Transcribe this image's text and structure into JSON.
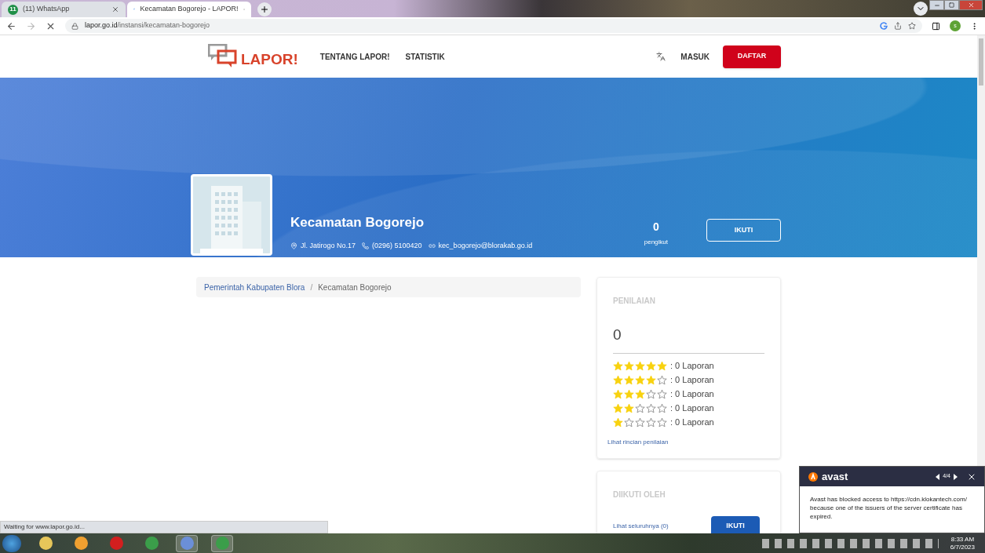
{
  "browser": {
    "tabs": [
      {
        "title": "(11) WhatsApp",
        "badge": "11",
        "selected": false
      },
      {
        "title": "Kecamatan Bogorejo - LAPOR!",
        "selected": true
      }
    ],
    "url_host": "lapor.go.id",
    "url_path": "/instansi/kecamatan-bogorejo",
    "profile_initial": "s"
  },
  "header": {
    "logo": "LAPOR!",
    "nav": [
      "TENTANG LAPOR!",
      "STATISTIK"
    ],
    "login": "MASUK",
    "register": "DAFTAR"
  },
  "profile": {
    "name": "Kecamatan Bogorejo",
    "address": "Jl. Jatirogo No.17",
    "phone": "(0296) 5100420",
    "email": "kec_bogorejo@blorakab.go.id",
    "followers_count": "0",
    "followers_label": "pengikut",
    "follow_button": "IKUTI"
  },
  "breadcrumb": [
    {
      "label": "Pemerintah Kabupaten Blora",
      "kind": "link"
    },
    {
      "label": "Kecamatan Bogorejo",
      "kind": "current"
    }
  ],
  "breadcrumb_separator": "/",
  "rating": {
    "title": "PENILAIAN",
    "score": "0",
    "rows": [
      {
        "stars": 5,
        "text": ": 0 Laporan"
      },
      {
        "stars": 4,
        "text": ": 0 Laporan"
      },
      {
        "stars": 3,
        "text": ": 0 Laporan"
      },
      {
        "stars": 2,
        "text": ": 0 Laporan"
      },
      {
        "stars": 1,
        "text": ": 0 Laporan"
      }
    ],
    "details_link": "Lihat rincian penilaian"
  },
  "followed_by": {
    "title": "DIIKUTI OLEH",
    "see_all": "Lihat seluruhnya (0)",
    "follow_button": "IKUTI"
  },
  "status_bar": "Waiting for www.lapor.go.id...",
  "avast": {
    "brand": "avast",
    "counter": "4/4",
    "message": "Avast has blocked access to https://cdn.klokantech.com/ because one of the issuers of the server certificate has expired."
  },
  "taskbar": {
    "time": "8:33 AM",
    "date": "6/7/2023"
  }
}
